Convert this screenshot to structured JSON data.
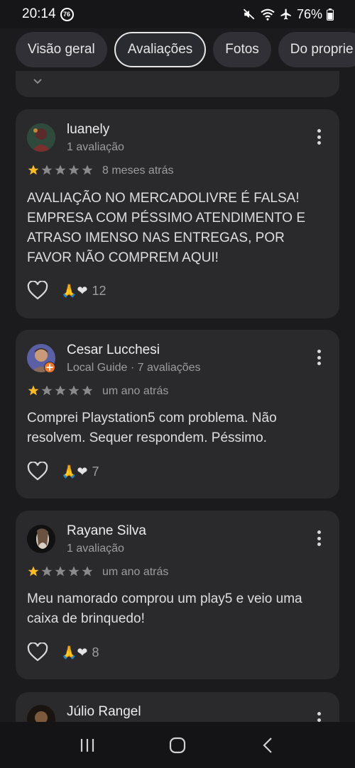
{
  "status_bar": {
    "time": "20:14",
    "notification_count": "76",
    "battery": "76%"
  },
  "tabs": [
    {
      "label": "Visão geral"
    },
    {
      "label": "Avaliações"
    },
    {
      "label": "Fotos"
    },
    {
      "label": "Do proprie"
    }
  ],
  "reviews": [
    {
      "name": "luanely",
      "meta": "1 avaliação",
      "rating": 1,
      "time": "8 meses atrás",
      "text": "AVALIAÇÃO NO MERCADOLIVRE É FALSA! EMPRESA COM PÉSSIMO ATENDIMENTO E ATRASO IMENSO NAS ENTREGAS, POR FAVOR NÃO COMPREM AQUI!",
      "reactions": "🙏❤",
      "reaction_count": "12"
    },
    {
      "name": "Cesar Lucchesi",
      "meta": "Local Guide · 7 avaliações",
      "rating": 1,
      "time": "um ano atrás",
      "text": "Comprei Playstation5 com problema. Não resolvem. Sequer respondem. Péssimo.",
      "reactions": "🙏❤",
      "reaction_count": "7"
    },
    {
      "name": "Rayane Silva",
      "meta": "1 avaliação",
      "rating": 1,
      "time": "um ano atrás",
      "text": "Meu namorado comprou um play5 e veio uma caixa de brinquedo!",
      "reactions": "🙏❤",
      "reaction_count": "8"
    },
    {
      "name": "Júlio Rangel"
    }
  ],
  "colors": {
    "star_filled": "#f9bb27",
    "star_empty": "#8a8a8d",
    "card_bg": "#2a2a2c",
    "page_bg": "#1b1b1d"
  }
}
